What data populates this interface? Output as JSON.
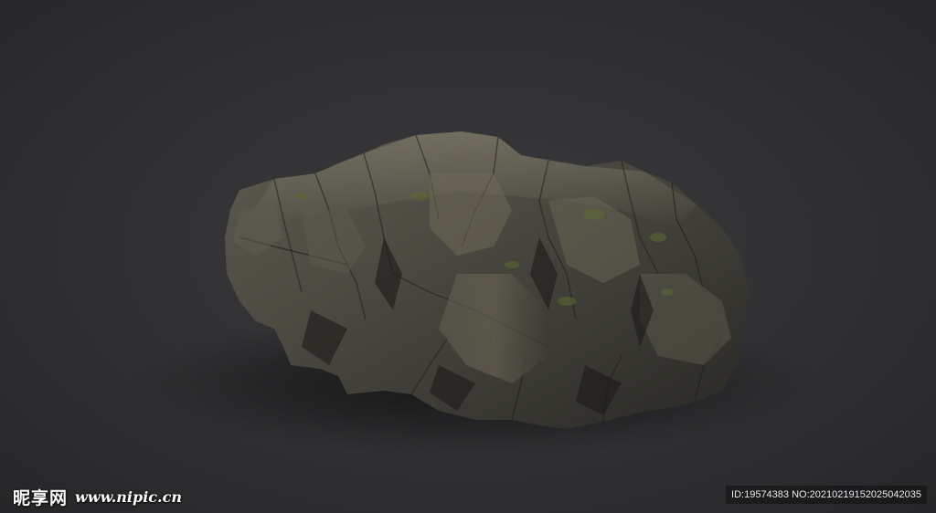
{
  "image": {
    "background_color": "#333335",
    "subject": "rock"
  },
  "watermark": {
    "brand": "昵享网",
    "url": "www.nipic.cn",
    "id_text": "ID:19574383 NO:20210219152025042035"
  }
}
